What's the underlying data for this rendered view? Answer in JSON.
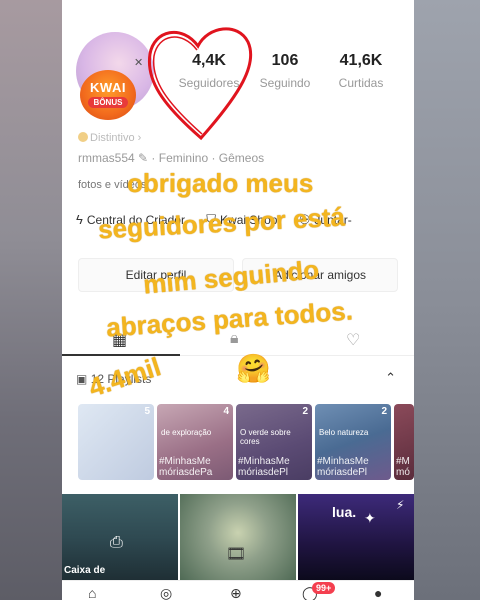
{
  "profile": {
    "badge_top": "KWAI",
    "badge_bottom": "BÔNUS",
    "stats": [
      {
        "value": "4,4K",
        "label": "Seguidores"
      },
      {
        "value": "106",
        "label": "Seguindo"
      },
      {
        "value": "41,6K",
        "label": "Curtidas"
      }
    ],
    "distintivo": "Distintivo",
    "username": "rmmas554",
    "gender": "Feminino",
    "sign": "Gêmeos",
    "bio": "fotos e vídeos."
  },
  "links": {
    "creator": "Central do Criador",
    "shop": "Kwai Shop",
    "extra": "Juntar-"
  },
  "buttons": {
    "edit": "Editar perfil",
    "add": "Adicionar amigos"
  },
  "playlists": {
    "label": "12 Playlists"
  },
  "thumbs": [
    {
      "count": "5",
      "caption": ""
    },
    {
      "count": "4",
      "sub": "de exploração",
      "caption": "#MinhasMe\nmóriasdePa"
    },
    {
      "count": "2",
      "sub": "O verde sobre cores",
      "caption": "#MinhasMe\nmóriasdePl"
    },
    {
      "count": "2",
      "sub": "Belo natureza",
      "caption": "#MinhasMe\nmóriasdePl"
    },
    {
      "count": "2",
      "sub": "",
      "caption": "#M\nmó"
    }
  ],
  "grid": {
    "cell1": "Caixa de",
    "cell3": "lua."
  },
  "nav": {
    "badge": "99+"
  },
  "overlay": {
    "line1": "obrigado meus",
    "line2": "seguidores por está",
    "line3": "mim seguindo",
    "line4": "abraços para todos.",
    "line5": "4.4mil",
    "emoji": "🤗"
  }
}
